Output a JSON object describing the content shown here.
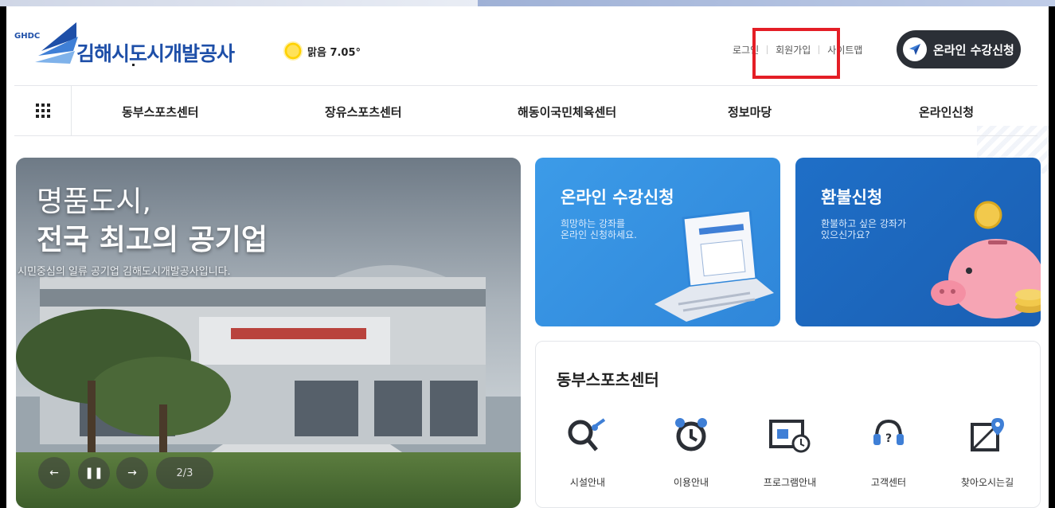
{
  "header": {
    "logo_small": "GHDC",
    "logo_text": "김해시도시개발공사",
    "weather": "맑음 7.05°",
    "util_links": [
      "로그인",
      "회원가입",
      "사이트맵"
    ],
    "cta_label": "온라인 수강신청"
  },
  "nav": {
    "items": [
      "동부스포츠센터",
      "장유스포츠센터",
      "해동이국민체육센터",
      "정보마당",
      "온라인신청"
    ]
  },
  "hero": {
    "title_line1": "명품도시,",
    "title_line2": "전국 최고의 공기업",
    "subtitle": "시민중심의 일류 공기업 김해도시개발공사입니다.",
    "pager": "2/3"
  },
  "cards": {
    "online": {
      "title": "온라인 수강신청",
      "desc": [
        "희망하는 강좌를",
        "온라인 신청하세요."
      ]
    },
    "refund": {
      "title": "환불신청",
      "desc": [
        "환불하고 싶은 강좌가",
        "있으신가요?"
      ]
    }
  },
  "info": {
    "title": "동부스포츠센터",
    "services": [
      "시설안내",
      "이용안내",
      "프로그램안내",
      "고객센터",
      "찾아오시는길"
    ]
  },
  "colors": {
    "brand": "#1e4fa8",
    "cta_bg": "#2b2f36",
    "highlight": "#e41e26",
    "card_online": "#3c9be8",
    "card_refund": "#1f6fc7"
  }
}
